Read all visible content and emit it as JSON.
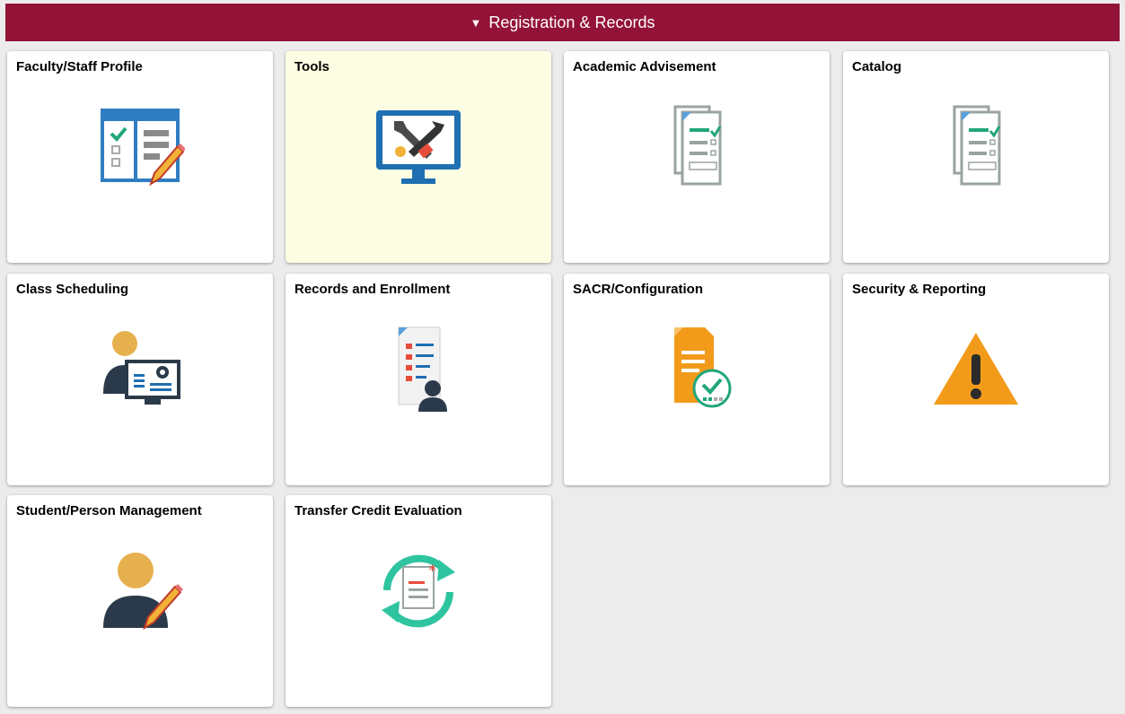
{
  "header": {
    "title": "Registration & Records",
    "toggle_icon": "triangle-down-icon"
  },
  "colors": {
    "header_bg": "#931238",
    "tile_highlight": "#fdfde3",
    "page_bg": "#ececec"
  },
  "tiles": [
    {
      "label": "Faculty/Staff Profile",
      "icon": "profile-form-edit-icon"
    },
    {
      "label": "Tools",
      "icon": "tools-monitor-icon"
    },
    {
      "label": "Academic Advisement",
      "icon": "checklist-documents-icon"
    },
    {
      "label": "Catalog",
      "icon": "checklist-documents-icon"
    },
    {
      "label": "Class Scheduling",
      "icon": "person-monitor-settings-icon"
    },
    {
      "label": "Records and Enrollment",
      "icon": "document-person-icon"
    },
    {
      "label": "SACR/Configuration",
      "icon": "document-approved-icon"
    },
    {
      "label": "Security & Reporting",
      "icon": "warning-icon"
    },
    {
      "label": "Student/Person Management",
      "icon": "person-edit-icon"
    },
    {
      "label": "Transfer Credit Evaluation",
      "icon": "document-transfer-icon"
    }
  ]
}
